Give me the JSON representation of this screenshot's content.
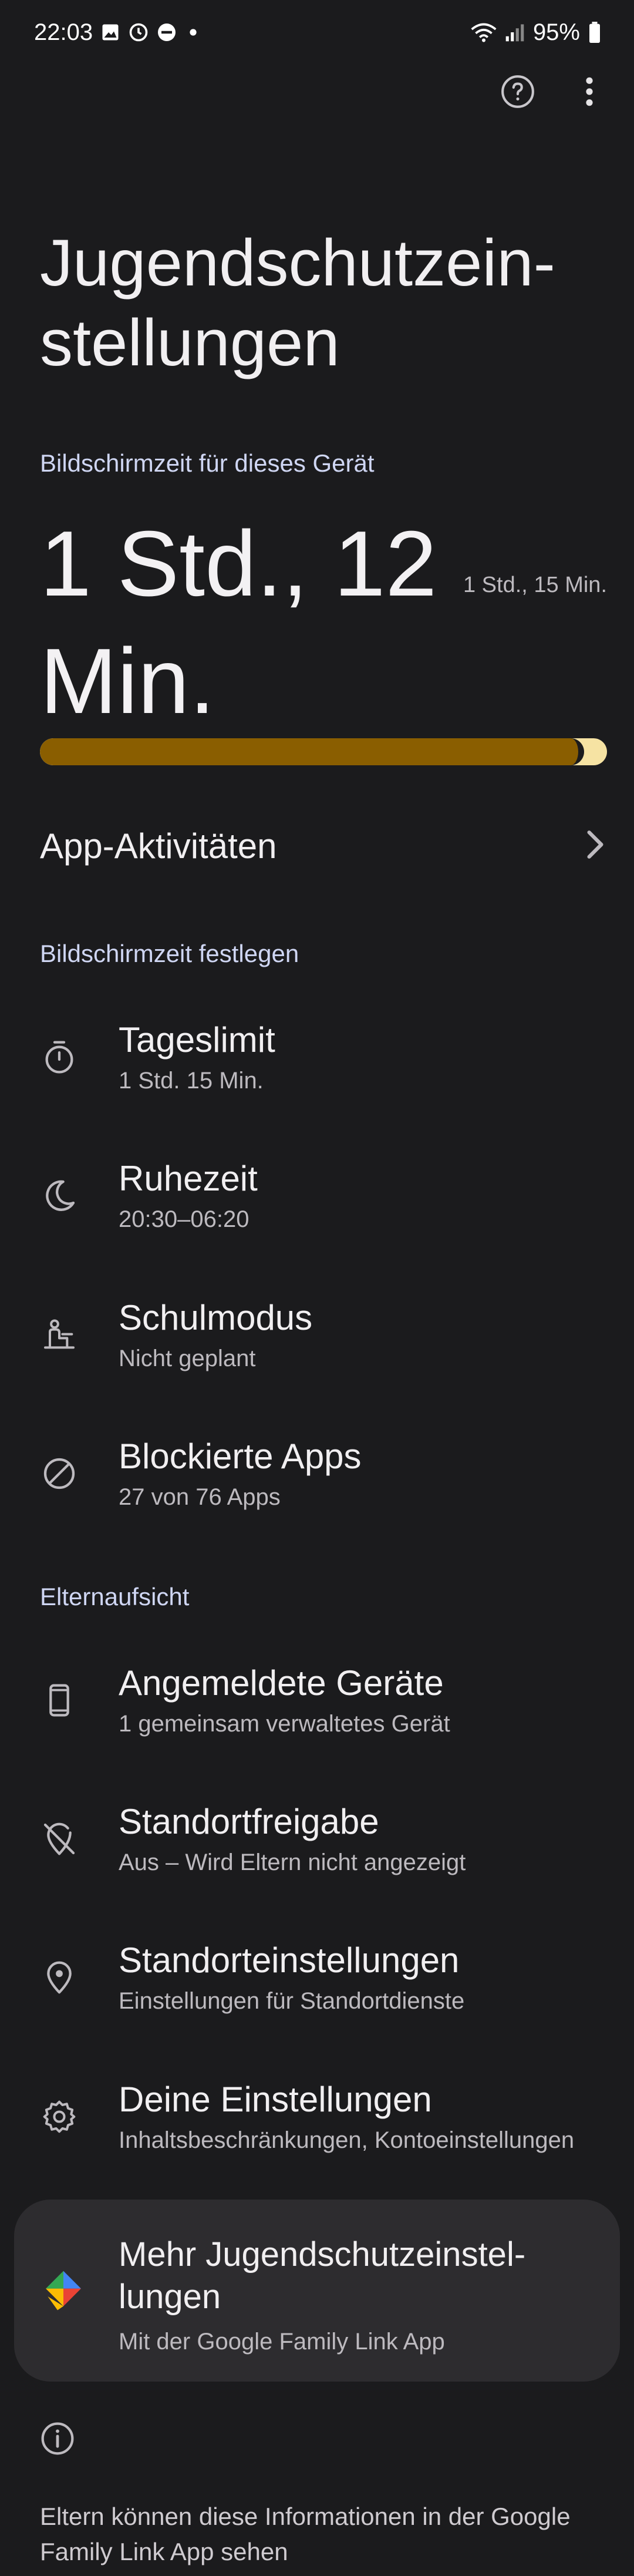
{
  "status_bar": {
    "time": "22:03",
    "battery": "95%",
    "icons": [
      "image-icon",
      "alarm-icon",
      "dnd-icon",
      "dot-icon",
      "wifi-icon",
      "signal-icon",
      "battery-icon"
    ]
  },
  "header": {
    "title": "Jugendschutzein-\nstellungen",
    "actions": [
      "help-icon",
      "more-options-icon"
    ]
  },
  "screen_time": {
    "section_label": "Bildschirmzeit für dieses Gerät",
    "used": "1 Std., 12 Min.",
    "limit": "1 Std., 15 Min.",
    "progress_fraction": 0.96,
    "colors": {
      "fill": "#8a5e00",
      "track": "#f6e3a3"
    }
  },
  "app_activity": {
    "label": "App-Aktivitäten"
  },
  "set_screen_time": {
    "section_label": "Bildschirmzeit festlegen",
    "items": [
      {
        "icon": "timer-icon",
        "title": "Tageslimit",
        "subtitle": "1 Std. 15 Min."
      },
      {
        "icon": "moon-icon",
        "title": "Ruhezeit",
        "subtitle": "20:30–06:20"
      },
      {
        "icon": "school-desk-icon",
        "title": "Schulmodus",
        "subtitle": "Nicht geplant"
      },
      {
        "icon": "block-icon",
        "title": "Blockierte Apps",
        "subtitle": "27 von 76 Apps"
      }
    ]
  },
  "parental_supervision": {
    "section_label": "Elternaufsicht",
    "items": [
      {
        "icon": "phone-icon",
        "title": "Angemeldete Geräte",
        "subtitle": "1 gemeinsam verwaltetes Gerät"
      },
      {
        "icon": "location-off-icon",
        "title": "Standortfreigabe",
        "subtitle": "Aus – Wird Eltern nicht angezeigt"
      },
      {
        "icon": "location-pin-icon",
        "title": "Standorteinstellungen",
        "subtitle": "Einstellungen für Standortdienste"
      },
      {
        "icon": "gear-icon",
        "title": "Deine Einstellungen",
        "subtitle": "Inhaltsbeschränkungen, Kontoeinstellungen"
      }
    ]
  },
  "family_link_card": {
    "icon": "family-link-icon",
    "title": "Mehr Jugendschutzeinstel-\nlungen",
    "subtitle": "Mit der Google Family Link App"
  },
  "footer": {
    "icon": "info-icon",
    "text": "Eltern können diese Informationen in der Google Family Link App sehen"
  }
}
